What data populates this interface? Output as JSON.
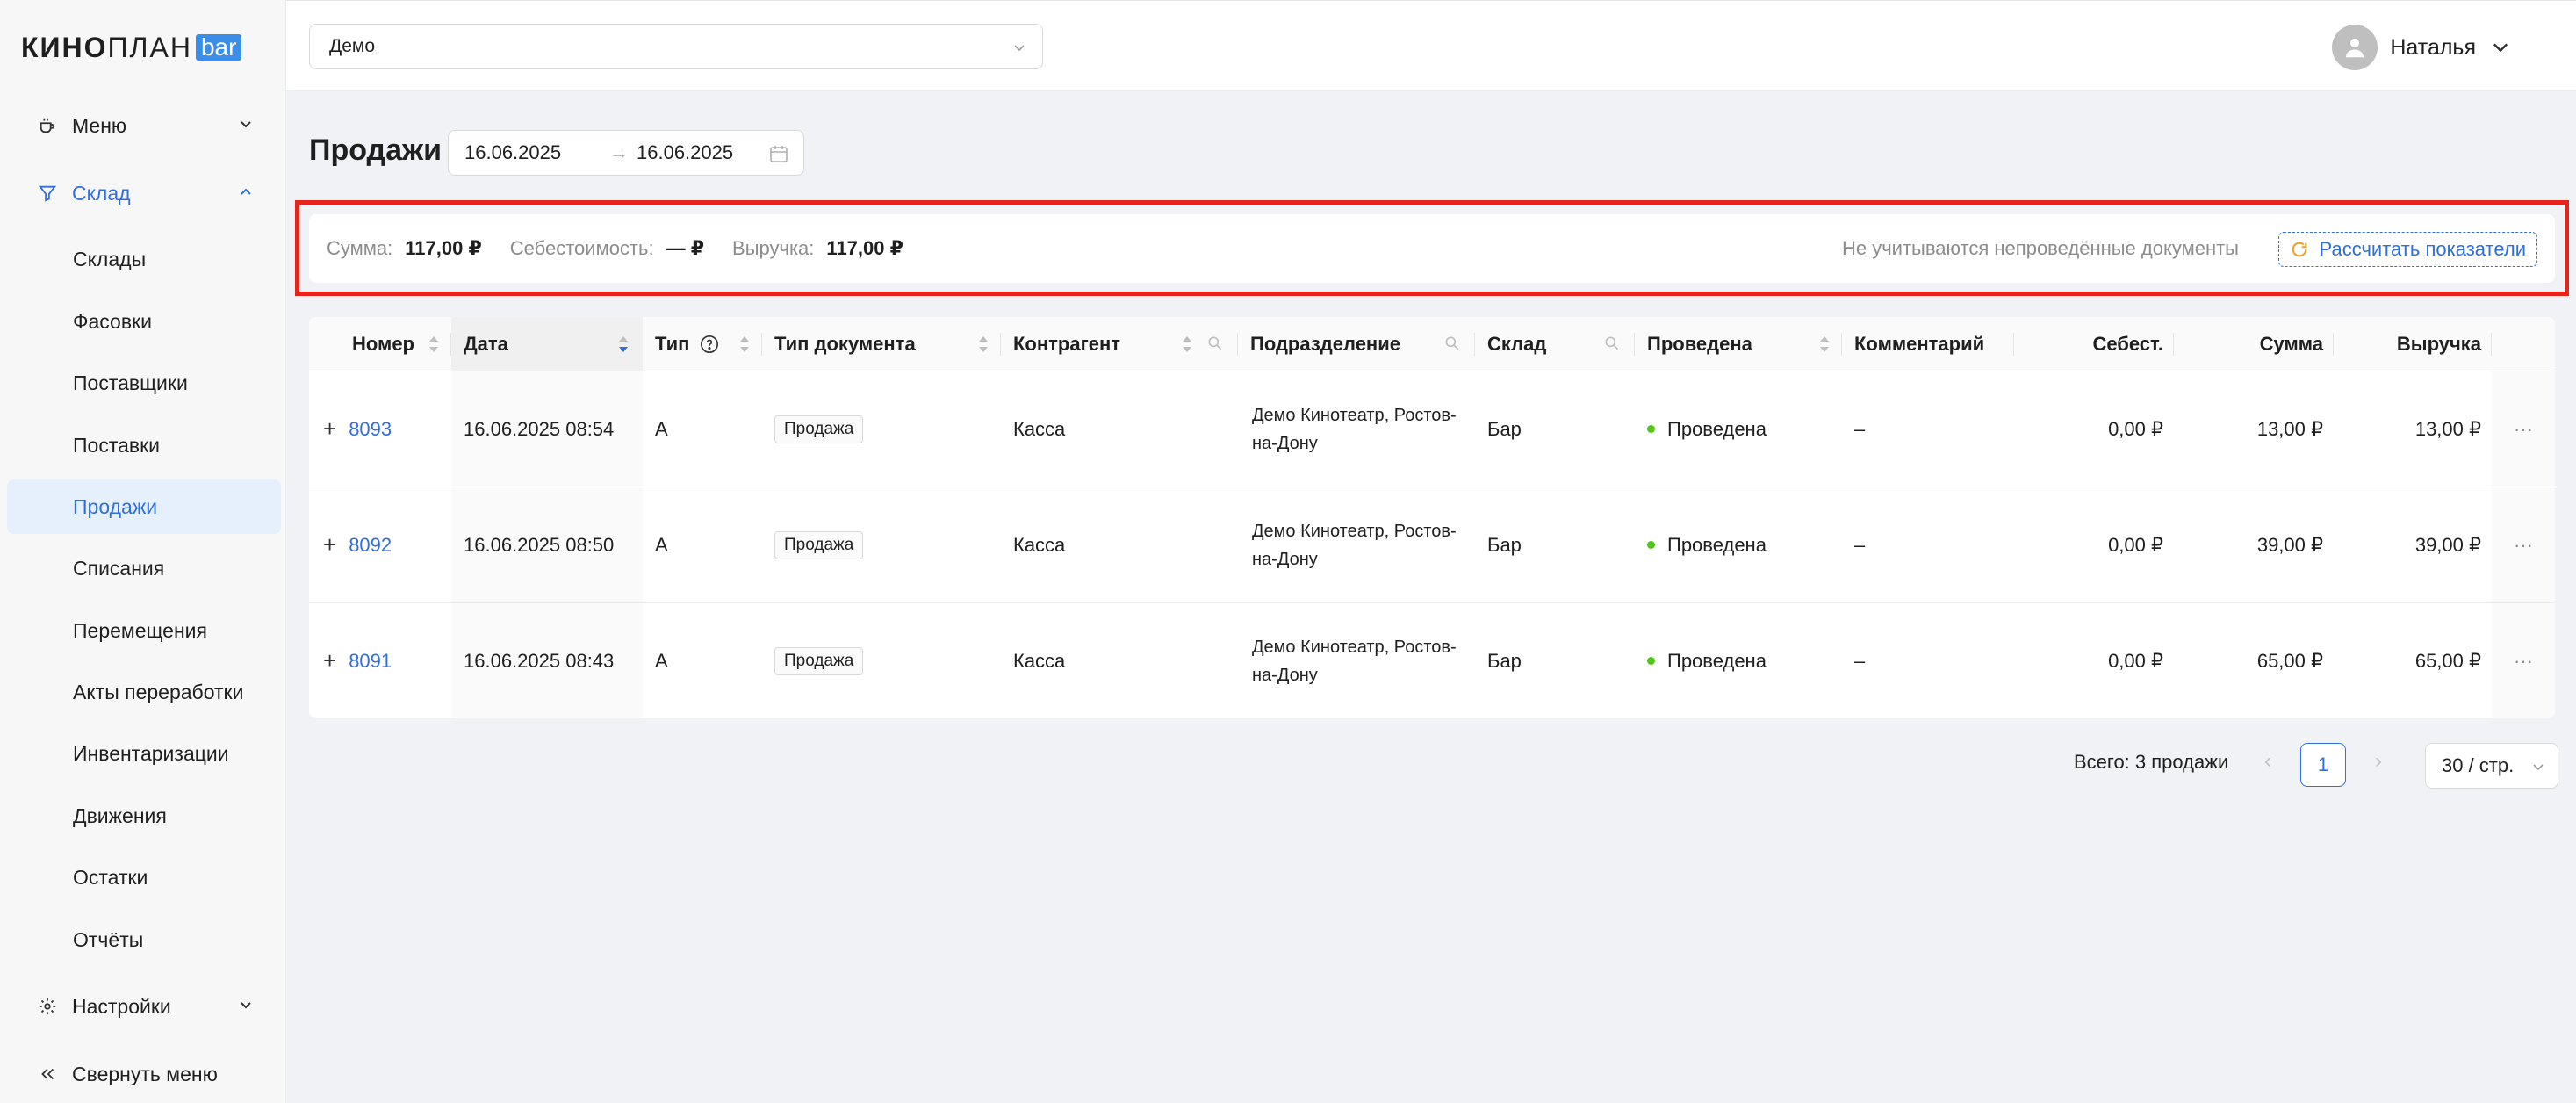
{
  "brand": {
    "kino": "КИНО",
    "plan": "ПЛАН",
    "bar": "bar"
  },
  "sidebar": {
    "menu_label": "Меню",
    "warehouse_label": "Склад",
    "items": [
      {
        "label": "Склады"
      },
      {
        "label": "Фасовки"
      },
      {
        "label": "Поставщики"
      },
      {
        "label": "Поставки"
      },
      {
        "label": "Продажи"
      },
      {
        "label": "Списания"
      },
      {
        "label": "Перемещения"
      },
      {
        "label": "Акты переработки"
      },
      {
        "label": "Инвентаризации"
      },
      {
        "label": "Движения"
      },
      {
        "label": "Остатки"
      },
      {
        "label": "Отчёты"
      }
    ],
    "settings_label": "Настройки",
    "collapse_label": "Свернуть меню"
  },
  "header": {
    "org_value": "Демо",
    "user_name": "Наталья"
  },
  "page": {
    "title": "Продажи",
    "date_from": "16.06.2025",
    "date_to": "16.06.2025",
    "date_arrow": "→"
  },
  "summary": {
    "sum_label": "Сумма:",
    "sum_value": "117,00 ₽",
    "cost_label": "Себестоимость:",
    "cost_value": "— ₽",
    "revenue_label": "Выручка:",
    "revenue_value": "117,00 ₽",
    "note": "Не учитываются непроведённые документы",
    "calc_button": "Рассчитать показатели"
  },
  "table": {
    "columns": {
      "number": "Номер",
      "date": "Дата",
      "type": "Тип",
      "doc_type": "Тип документа",
      "counterparty": "Контрагент",
      "division": "Подразделение",
      "warehouse": "Склад",
      "posted": "Проведена",
      "comment": "Комментарий",
      "cost": "Себест.",
      "sum": "Сумма",
      "revenue": "Выручка"
    },
    "rows": [
      {
        "expand": "+",
        "number": "8093",
        "date": "16.06.2025 08:54",
        "type": "А",
        "doc_type": "Продажа",
        "counterparty": "Касса",
        "division_1": "Демо Кинотеатр, Ростов-",
        "division_2": "на-Дону",
        "warehouse": "Бар",
        "posted": "Проведена",
        "comment": "–",
        "cost": "0,00 ₽",
        "sum": "13,00 ₽",
        "revenue": "13,00 ₽",
        "more": "···"
      },
      {
        "expand": "+",
        "number": "8092",
        "date": "16.06.2025 08:50",
        "type": "А",
        "doc_type": "Продажа",
        "counterparty": "Касса",
        "division_1": "Демо Кинотеатр, Ростов-",
        "division_2": "на-Дону",
        "warehouse": "Бар",
        "posted": "Проведена",
        "comment": "–",
        "cost": "0,00 ₽",
        "sum": "39,00 ₽",
        "revenue": "39,00 ₽",
        "more": "···"
      },
      {
        "expand": "+",
        "number": "8091",
        "date": "16.06.2025 08:43",
        "type": "А",
        "doc_type": "Продажа",
        "counterparty": "Касса",
        "division_1": "Демо Кинотеатр, Ростов-",
        "division_2": "на-Дону",
        "warehouse": "Бар",
        "posted": "Проведена",
        "comment": "–",
        "cost": "0,00 ₽",
        "sum": "65,00 ₽",
        "revenue": "65,00 ₽",
        "more": "···"
      }
    ]
  },
  "pagination": {
    "total": "Всего: 3 продажи",
    "prev": "‹",
    "current": "1",
    "next": "›",
    "page_size": "30 / стр."
  },
  "colors": {
    "accent": "#2f6fdf",
    "highlight_outline": "#e8241a",
    "status_green": "#52c41a"
  }
}
